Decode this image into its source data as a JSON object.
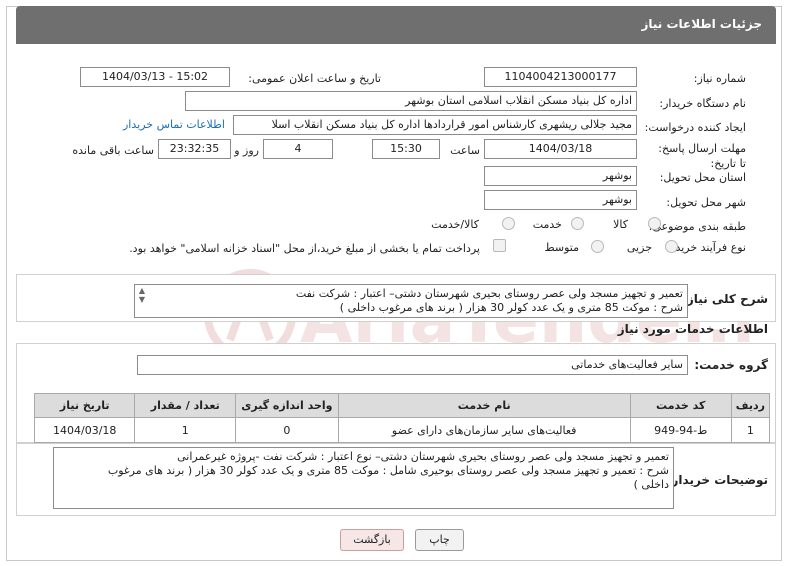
{
  "header": {
    "title": "جزئیات اطلاعات نیاز"
  },
  "fields": {
    "need_number_label": "شماره نیاز:",
    "need_number": "1104004213000177",
    "announce_label": "تاریخ و ساعت اعلان عمومی:",
    "announce_value": "1404/03/13 - 15:02",
    "buyer_label": "نام دستگاه خریدار:",
    "buyer_value": "اداره کل بنیاد مسکن انقلاب اسلامی استان بوشهر",
    "creator_label": "ایجاد کننده درخواست:",
    "creator_value": "مجید جلالی ریشهری کارشناس امور قراردادها اداره کل بنیاد مسکن انقلاب اسلا",
    "contact_link": "اطلاعات تماس خریدار",
    "deadline_label": "مهلت ارسال پاسخ: تا تاریخ:",
    "deadline_date": "1404/03/18",
    "time_label": "ساعت",
    "deadline_time": "15:30",
    "days_value": "4",
    "days_label": "روز و",
    "remaining_time": "23:32:35",
    "remaining_label": "ساعت باقی مانده",
    "province_label": "استان محل تحویل:",
    "province_value": "بوشهر",
    "city_label": "شهر محل تحویل:",
    "city_value": "بوشهر",
    "category_label": "طبقه بندی موضوعی:",
    "category_options": [
      "کالا",
      "خدمت",
      "کالا/خدمت"
    ],
    "process_label": "نوع فرآیند خرید :",
    "process_options": [
      "جزیی",
      "متوسط"
    ],
    "payment_note": "پرداخت تمام یا بخشی از مبلغ خرید،از محل \"اسناد خزانه اسلامی\" خواهد بود."
  },
  "summary": {
    "label": "شرح کلی نیاز:",
    "line1": "تعمیر و تجهیز مسجد ولی عصر روستای بحیری شهرستان دشتی– اعتبار : شرکت نفت",
    "line2": "شرح : موکت 85 متری و یک عدد کولر 30 هزار  ( برند های مرغوب داخلی )"
  },
  "services": {
    "title": "اطلاعات خدمات مورد نیاز",
    "group_label": "گروه خدمت:",
    "group_value": "سایر فعالیت‌های خدماتی",
    "columns": [
      "ردیف",
      "کد خدمت",
      "نام خدمت",
      "واحد اندازه گیری",
      "تعداد / مقدار",
      "تاریخ نیاز"
    ],
    "rows": [
      [
        "1",
        "ط-94-949",
        "فعالیت‌های سایر سازمان‌های دارای عضو",
        "0",
        "1",
        "1404/03/18"
      ]
    ]
  },
  "buyer_notes": {
    "label": "توضیحات خریدار:",
    "line1": "تعمیر و تجهیز مسجد ولی عصر روستای بحیری شهرستان دشتی– نوع اعتبار : شرکت نفت -پروژه غیرعمرانی",
    "line2": "شرح : تعمیر و تجهیز مسجد ولی عصر روستای بوحیری شامل : موکت 85 متری و یک عدد کولر 30 هزار  ( برند های مرغوب",
    "line3": "داخلی )"
  },
  "buttons": {
    "print": "چاپ",
    "back": "بازگشت"
  },
  "colors": {
    "header_bg": "#6f6f6f",
    "link": "#1a6fb5",
    "back_button_bg": "#f6e6e6"
  }
}
